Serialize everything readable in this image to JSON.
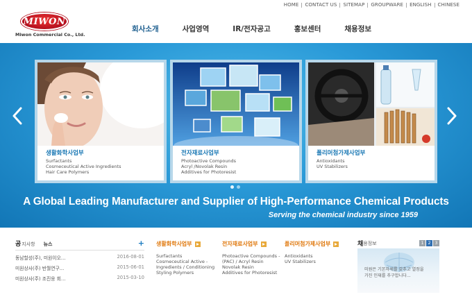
{
  "header": {
    "util_links": [
      "HOME",
      "CONTACT US",
      "SITEMAP",
      "GROUPWARE",
      "ENGLISH",
      "CHINESE"
    ],
    "logo_text": "MIWON",
    "logo_sub": "Miwon Commercial Co., Ltd.",
    "nav": [
      {
        "label": "회사소개",
        "active": true
      },
      {
        "label": "사업영역",
        "active": false
      },
      {
        "label": "IR/전자공고",
        "active": false
      },
      {
        "label": "홍보센터",
        "active": false
      },
      {
        "label": "채용정보",
        "active": false
      }
    ]
  },
  "hero": {
    "cards": [
      {
        "title": "생활화학사업부",
        "lines": [
          "Surfactants",
          "Cosmeceutical Active Ingredients",
          "Hair Care Polymers"
        ]
      },
      {
        "title": "전자재료사업부",
        "lines": [
          "Photoactive Compounds",
          "Acryl /Novolak Resin",
          "Additives for Photoresist"
        ]
      },
      {
        "title": "폴리머첨가제사업부",
        "lines": [
          "Antioxidants",
          "UV Stabilizers"
        ]
      }
    ],
    "headline": "A Global Leading Manufacturer and Supplier of High-Performance Chemical Products",
    "tagline": "Serving the chemical industry since 1959",
    "slide_count": 2,
    "active_slide": 1
  },
  "news": {
    "title_part1": "공",
    "title_part2": "지사항",
    "title_part3": "뉴스",
    "plus": "+",
    "items": [
      {
        "text": "동남할성(주), 미원이오...",
        "date": "2016-08-01"
      },
      {
        "text": "미원상사(주) 반월연구...",
        "date": "2015-06-01"
      },
      {
        "text": "미원상사(주) 조진웅 회...",
        "date": "2015-03-10"
      }
    ]
  },
  "business": [
    {
      "title": "생활화학사업부",
      "lines": [
        "Surfactants",
        "Cosmeceutical Active -",
        "Ingredients / Conditioning",
        "Styling Polymers"
      ]
    },
    {
      "title": "전자재료사업부",
      "lines": [
        "Photoactive Compounds -",
        "(PAC) / Acryl Resin",
        "Novolak Resin",
        "Additives for Photoresist"
      ]
    },
    {
      "title": "폴리머첨가제사업부",
      "lines": [
        "Antioxidants",
        "UV Stabilizers"
      ]
    }
  ],
  "recruit": {
    "title_part1": "채",
    "title_part2": "용정보",
    "pages": [
      "1",
      "2",
      "3"
    ],
    "active_page": "2",
    "text_lines": [
      "미원은 기본자세를 갖추고 열정을",
      "가진 인재를 추구합니다..."
    ]
  },
  "colors": {
    "brand_red": "#b4101f",
    "hero_blue": "#2a9ad8",
    "accent_blue": "#1a78b4",
    "accent_orange": "#e07a10"
  }
}
